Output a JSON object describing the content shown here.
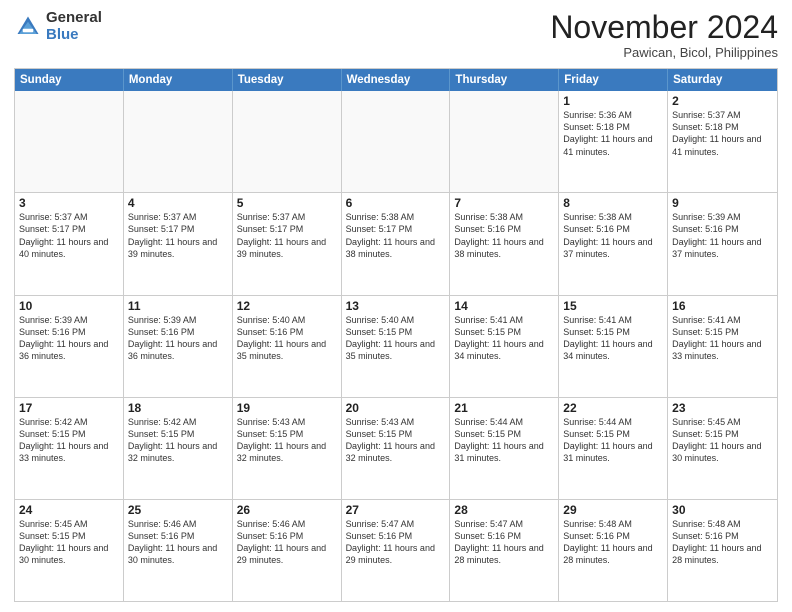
{
  "logo": {
    "general": "General",
    "blue": "Blue"
  },
  "header": {
    "month": "November 2024",
    "location": "Pawican, Bicol, Philippines"
  },
  "days": [
    "Sunday",
    "Monday",
    "Tuesday",
    "Wednesday",
    "Thursday",
    "Friday",
    "Saturday"
  ],
  "weeks": [
    [
      {
        "day": "",
        "empty": true
      },
      {
        "day": "",
        "empty": true
      },
      {
        "day": "",
        "empty": true
      },
      {
        "day": "",
        "empty": true
      },
      {
        "day": "",
        "empty": true
      },
      {
        "day": "1",
        "sunrise": "Sunrise: 5:36 AM",
        "sunset": "Sunset: 5:18 PM",
        "daylight": "Daylight: 11 hours and 41 minutes."
      },
      {
        "day": "2",
        "sunrise": "Sunrise: 5:37 AM",
        "sunset": "Sunset: 5:18 PM",
        "daylight": "Daylight: 11 hours and 41 minutes."
      }
    ],
    [
      {
        "day": "3",
        "sunrise": "Sunrise: 5:37 AM",
        "sunset": "Sunset: 5:17 PM",
        "daylight": "Daylight: 11 hours and 40 minutes."
      },
      {
        "day": "4",
        "sunrise": "Sunrise: 5:37 AM",
        "sunset": "Sunset: 5:17 PM",
        "daylight": "Daylight: 11 hours and 39 minutes."
      },
      {
        "day": "5",
        "sunrise": "Sunrise: 5:37 AM",
        "sunset": "Sunset: 5:17 PM",
        "daylight": "Daylight: 11 hours and 39 minutes."
      },
      {
        "day": "6",
        "sunrise": "Sunrise: 5:38 AM",
        "sunset": "Sunset: 5:17 PM",
        "daylight": "Daylight: 11 hours and 38 minutes."
      },
      {
        "day": "7",
        "sunrise": "Sunrise: 5:38 AM",
        "sunset": "Sunset: 5:16 PM",
        "daylight": "Daylight: 11 hours and 38 minutes."
      },
      {
        "day": "8",
        "sunrise": "Sunrise: 5:38 AM",
        "sunset": "Sunset: 5:16 PM",
        "daylight": "Daylight: 11 hours and 37 minutes."
      },
      {
        "day": "9",
        "sunrise": "Sunrise: 5:39 AM",
        "sunset": "Sunset: 5:16 PM",
        "daylight": "Daylight: 11 hours and 37 minutes."
      }
    ],
    [
      {
        "day": "10",
        "sunrise": "Sunrise: 5:39 AM",
        "sunset": "Sunset: 5:16 PM",
        "daylight": "Daylight: 11 hours and 36 minutes."
      },
      {
        "day": "11",
        "sunrise": "Sunrise: 5:39 AM",
        "sunset": "Sunset: 5:16 PM",
        "daylight": "Daylight: 11 hours and 36 minutes."
      },
      {
        "day": "12",
        "sunrise": "Sunrise: 5:40 AM",
        "sunset": "Sunset: 5:16 PM",
        "daylight": "Daylight: 11 hours and 35 minutes."
      },
      {
        "day": "13",
        "sunrise": "Sunrise: 5:40 AM",
        "sunset": "Sunset: 5:15 PM",
        "daylight": "Daylight: 11 hours and 35 minutes."
      },
      {
        "day": "14",
        "sunrise": "Sunrise: 5:41 AM",
        "sunset": "Sunset: 5:15 PM",
        "daylight": "Daylight: 11 hours and 34 minutes."
      },
      {
        "day": "15",
        "sunrise": "Sunrise: 5:41 AM",
        "sunset": "Sunset: 5:15 PM",
        "daylight": "Daylight: 11 hours and 34 minutes."
      },
      {
        "day": "16",
        "sunrise": "Sunrise: 5:41 AM",
        "sunset": "Sunset: 5:15 PM",
        "daylight": "Daylight: 11 hours and 33 minutes."
      }
    ],
    [
      {
        "day": "17",
        "sunrise": "Sunrise: 5:42 AM",
        "sunset": "Sunset: 5:15 PM",
        "daylight": "Daylight: 11 hours and 33 minutes."
      },
      {
        "day": "18",
        "sunrise": "Sunrise: 5:42 AM",
        "sunset": "Sunset: 5:15 PM",
        "daylight": "Daylight: 11 hours and 32 minutes."
      },
      {
        "day": "19",
        "sunrise": "Sunrise: 5:43 AM",
        "sunset": "Sunset: 5:15 PM",
        "daylight": "Daylight: 11 hours and 32 minutes."
      },
      {
        "day": "20",
        "sunrise": "Sunrise: 5:43 AM",
        "sunset": "Sunset: 5:15 PM",
        "daylight": "Daylight: 11 hours and 32 minutes."
      },
      {
        "day": "21",
        "sunrise": "Sunrise: 5:44 AM",
        "sunset": "Sunset: 5:15 PM",
        "daylight": "Daylight: 11 hours and 31 minutes."
      },
      {
        "day": "22",
        "sunrise": "Sunrise: 5:44 AM",
        "sunset": "Sunset: 5:15 PM",
        "daylight": "Daylight: 11 hours and 31 minutes."
      },
      {
        "day": "23",
        "sunrise": "Sunrise: 5:45 AM",
        "sunset": "Sunset: 5:15 PM",
        "daylight": "Daylight: 11 hours and 30 minutes."
      }
    ],
    [
      {
        "day": "24",
        "sunrise": "Sunrise: 5:45 AM",
        "sunset": "Sunset: 5:15 PM",
        "daylight": "Daylight: 11 hours and 30 minutes."
      },
      {
        "day": "25",
        "sunrise": "Sunrise: 5:46 AM",
        "sunset": "Sunset: 5:16 PM",
        "daylight": "Daylight: 11 hours and 30 minutes."
      },
      {
        "day": "26",
        "sunrise": "Sunrise: 5:46 AM",
        "sunset": "Sunset: 5:16 PM",
        "daylight": "Daylight: 11 hours and 29 minutes."
      },
      {
        "day": "27",
        "sunrise": "Sunrise: 5:47 AM",
        "sunset": "Sunset: 5:16 PM",
        "daylight": "Daylight: 11 hours and 29 minutes."
      },
      {
        "day": "28",
        "sunrise": "Sunrise: 5:47 AM",
        "sunset": "Sunset: 5:16 PM",
        "daylight": "Daylight: 11 hours and 28 minutes."
      },
      {
        "day": "29",
        "sunrise": "Sunrise: 5:48 AM",
        "sunset": "Sunset: 5:16 PM",
        "daylight": "Daylight: 11 hours and 28 minutes."
      },
      {
        "day": "30",
        "sunrise": "Sunrise: 5:48 AM",
        "sunset": "Sunset: 5:16 PM",
        "daylight": "Daylight: 11 hours and 28 minutes."
      }
    ]
  ]
}
